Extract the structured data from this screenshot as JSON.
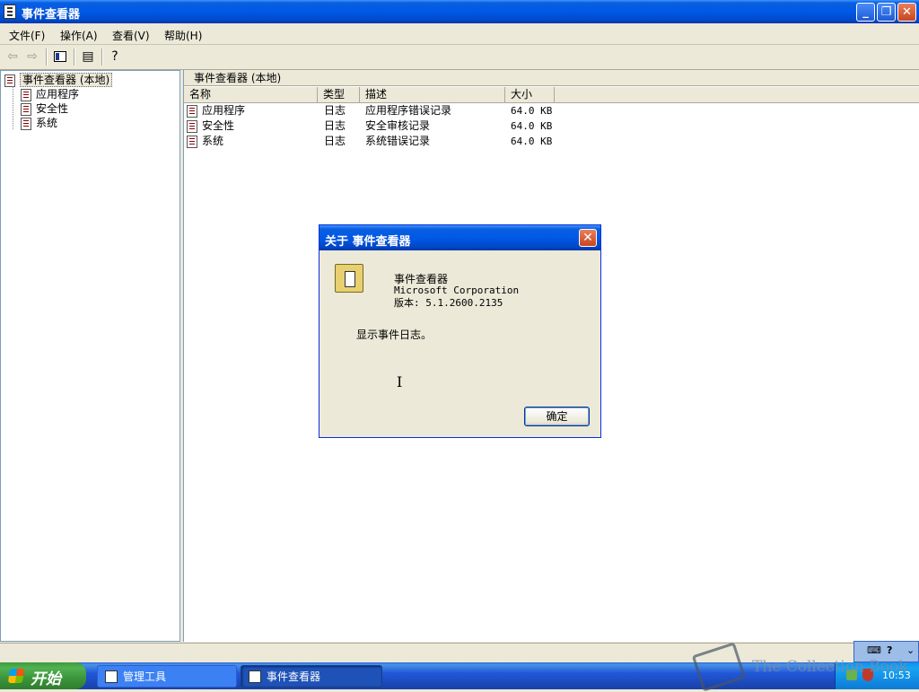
{
  "window": {
    "title": "事件查看器"
  },
  "menu": [
    "文件(F)",
    "操作(A)",
    "查看(V)",
    "帮助(H)"
  ],
  "tree": {
    "root": "事件查看器 (本地)",
    "items": [
      "应用程序",
      "安全性",
      "系统"
    ]
  },
  "pane_header": "事件查看器 (本地)",
  "columns": [
    "名称",
    "类型",
    "描述",
    "大小"
  ],
  "rows": [
    {
      "name": "应用程序",
      "type": "日志",
      "desc": "应用程序错误记录",
      "size": "64.0 KB"
    },
    {
      "name": "安全性",
      "type": "日志",
      "desc": "安全审核记录",
      "size": "64.0 KB"
    },
    {
      "name": "系统",
      "type": "日志",
      "desc": "系统错误记录",
      "size": "64.0 KB"
    }
  ],
  "dialog": {
    "title": "关于 事件查看器",
    "app_name": "事件查看器",
    "company": "Microsoft Corporation",
    "version": "版本: 5.1.2600.2135",
    "description": "显示事件日志。",
    "ok_label": "确定"
  },
  "taskbar": {
    "start_label": "开始",
    "tasks": [
      "管理工具",
      "事件查看器"
    ],
    "clock": "10:53"
  },
  "watermark": "The Collection Book",
  "colors": {
    "xp_blue": "#0058e6",
    "face": "#ece9d8",
    "start_green": "#3a953a"
  }
}
